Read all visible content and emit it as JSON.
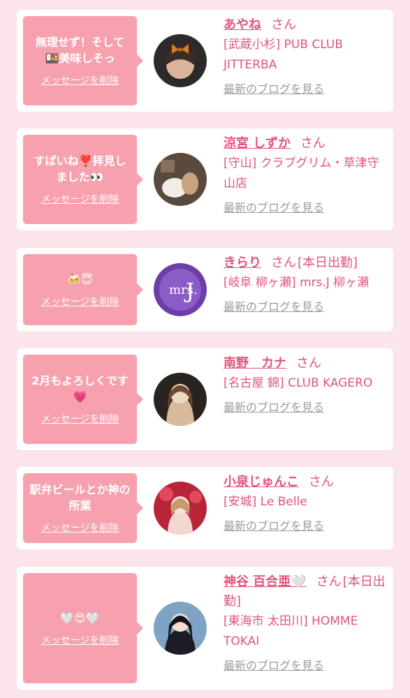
{
  "delete_label": "メッセージを削除",
  "blog_label": "最新のブログを見る",
  "san_label": "さん",
  "colors": {
    "accent": "#e0557a",
    "bubble": "#f7a0ae",
    "page_bg": "#fbe4ea",
    "link_gray": "#9a9a9a"
  },
  "items": [
    {
      "message": "無理せず！そして🍱美味しそっ",
      "name": "あやね",
      "status": "",
      "shop": "[武蔵小杉] PUB CLUB JITTERBA"
    },
    {
      "message": "すぱいね❣️拝見しました👀",
      "name": "涼宮 しずか",
      "status": "",
      "shop": "[守山] クラブグリム・草津守山店"
    },
    {
      "message": "🍻😇",
      "name": "きらり",
      "status": "[本日出勤]",
      "shop": "[岐阜 柳ヶ瀬] mrs.J 柳ヶ瀬"
    },
    {
      "message": "2月もよろしくです💗",
      "name": "南野　カナ",
      "status": "",
      "shop": "[名古屋 錦] CLUB KAGERO"
    },
    {
      "message": "駅弁ビールとか神の所業",
      "name": "小泉じゅんこ",
      "status": "",
      "shop": "[安城] Le Belle"
    },
    {
      "message": "🤍😍🤍",
      "name": "神谷 百合亜🤍",
      "status": "[本日出勤]",
      "shop": "[東海市 太田川] HOMME TOKAI"
    }
  ]
}
